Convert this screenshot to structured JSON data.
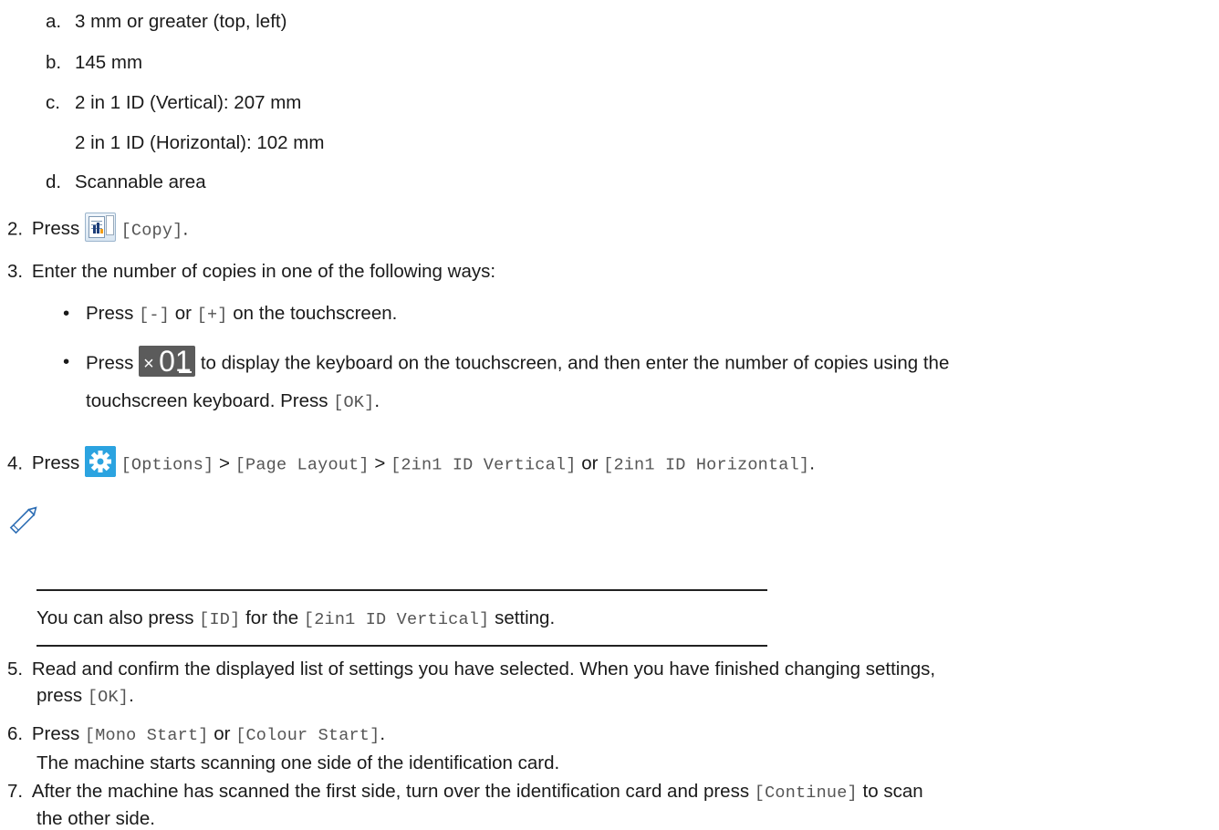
{
  "list_a": {
    "marker": "a.",
    "text": "3 mm or greater (top, left)"
  },
  "list_b": {
    "marker": "b.",
    "text": "145 mm"
  },
  "list_c": {
    "marker": "c.",
    "text1": "2 in 1 ID (Vertical): 207 mm",
    "text2": "2 in 1 ID (Horizontal): 102 mm"
  },
  "list_d": {
    "marker": "d.",
    "text": "Scannable area"
  },
  "step2": {
    "num": "2.",
    "press": "Press",
    "copy_btn": "[Copy]",
    "end": "."
  },
  "step3": {
    "num": "3.",
    "text": "Enter the number of copies in one of the following ways:",
    "bullet1": {
      "press": "Press",
      "minus": "[-]",
      "or": "or",
      "plus": "[+]",
      "rest": "on the touchscreen."
    },
    "bullet2": {
      "press": "Press",
      "rest1": "to display the keyboard on the touchscreen, and then enter the number of copies using the",
      "rest2a": "touchscreen keyboard. Press",
      "ok": "[OK]",
      "end": "."
    },
    "bullet_char": "•"
  },
  "copies_icon": {
    "x": "×",
    "digits": "01"
  },
  "step4": {
    "num": "4.",
    "press": "Press",
    "options": "[Options]",
    "sep1": ">",
    "page_layout": "[Page Layout]",
    "sep2": ">",
    "vertical": "[2in1 ID Vertical]",
    "or": "or",
    "horizontal": "[2in1 ID Horizontal]",
    "end": "."
  },
  "note": {
    "pre": "You can also press",
    "id_btn": "[ID]",
    "mid": "for the",
    "setting": "[2in1 ID Vertical]",
    "post": "setting."
  },
  "step5": {
    "num": "5.",
    "line1": "Read and confirm the displayed list of settings you have selected. When you have finished changing settings,",
    "press": "press",
    "ok": "[OK]",
    "end": "."
  },
  "step6": {
    "num": "6.",
    "press": "Press",
    "mono": "[Mono Start]",
    "or": "or",
    "colour": "[Colour Start]",
    "end": ".",
    "sub": "The machine starts scanning one side of the identification card."
  },
  "step7": {
    "num": "7.",
    "line1a": "After the machine has scanned the first side, turn over the identification card and press",
    "cont": "[Continue]",
    "line1b": "to scan",
    "line2": "the other side."
  },
  "colors": {
    "accent_blue": "#2ba3e0",
    "icon_grey": "#5b5b5b"
  }
}
